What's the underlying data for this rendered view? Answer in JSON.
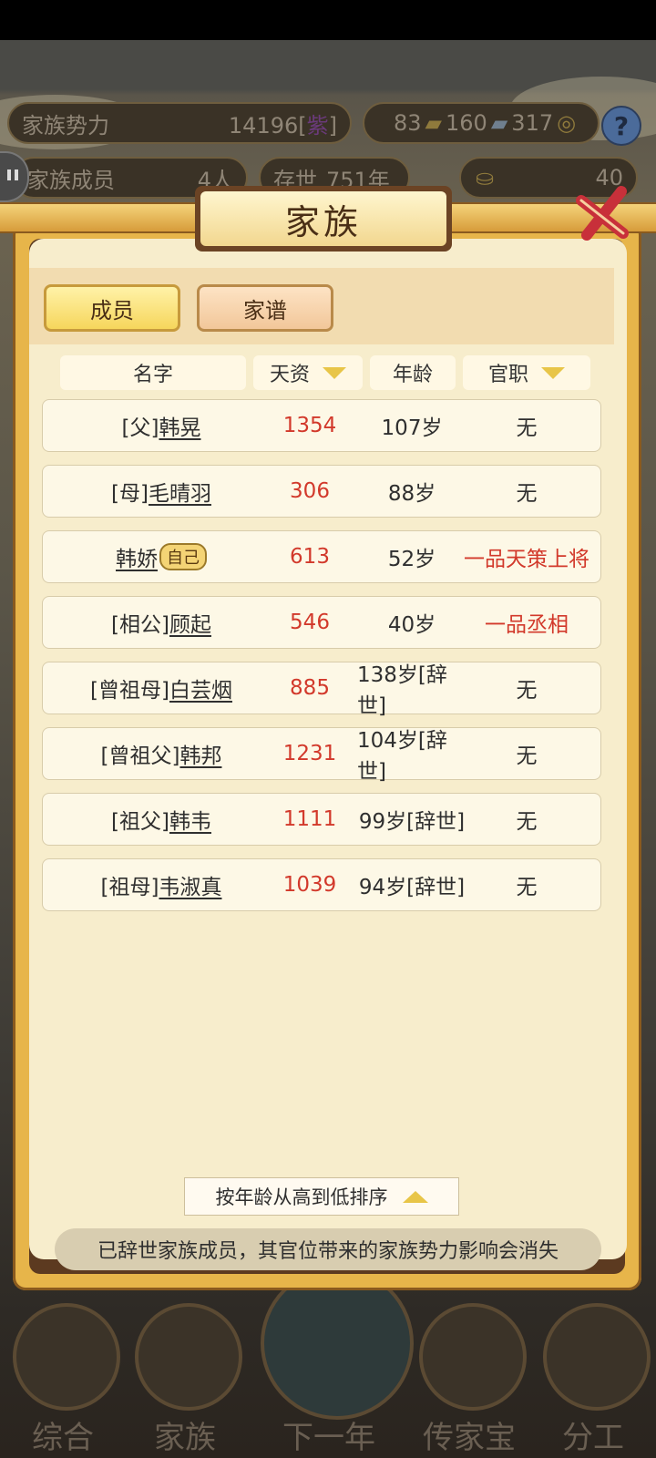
{
  "hud": {
    "power_label": "家族势力",
    "power_value": "14196[",
    "power_tier": "紫",
    "power_suffix": "]",
    "currency1": "83",
    "currency2": "160",
    "currency3": "317",
    "members_label": "家族成员",
    "members_value": "4人",
    "alive_label": "存世",
    "alive_value": "751年",
    "gold_value": "40"
  },
  "dialog": {
    "title": "家族",
    "tabs": [
      {
        "label": "成员",
        "active": true
      },
      {
        "label": "家谱",
        "active": false
      }
    ],
    "columns": [
      "名字",
      "天资",
      "年龄",
      "官职"
    ],
    "rows": [
      {
        "relation": "[父]",
        "name": "韩晃",
        "talent": "1354",
        "age": "107岁",
        "office": "无",
        "office_highlight": false
      },
      {
        "relation": "[母]",
        "name": "毛晴羽",
        "talent": "306",
        "age": "88岁",
        "office": "无",
        "office_highlight": false
      },
      {
        "relation": "",
        "name": "韩娇",
        "badge": "自己",
        "talent": "613",
        "age": "52岁",
        "office": "一品天策上将",
        "office_highlight": true
      },
      {
        "relation": "[相公]",
        "name": "顾起",
        "talent": "546",
        "age": "40岁",
        "office": "一品丞相",
        "office_highlight": true
      },
      {
        "relation": "[曾祖母]",
        "name": "白芸烟",
        "talent": "885",
        "age": "138岁[辞世]",
        "office": "无",
        "office_highlight": false
      },
      {
        "relation": "[曾祖父]",
        "name": "韩邦",
        "talent": "1231",
        "age": "104岁[辞世]",
        "office": "无",
        "office_highlight": false
      },
      {
        "relation": "[祖父]",
        "name": "韩韦",
        "talent": "1111",
        "age": "99岁[辞世]",
        "office": "无",
        "office_highlight": false
      },
      {
        "relation": "[祖母]",
        "name": "韦淑真",
        "talent": "1039",
        "age": "94岁[辞世]",
        "office": "无",
        "office_highlight": false
      }
    ],
    "sort_label": "按年龄从高到低排序",
    "notice": "已辞世家族成员，其官位带来的家族势力影响会消失"
  },
  "bottom_nav": [
    "综合",
    "家族",
    "下一年",
    "传家宝",
    "分工"
  ],
  "colors": {
    "accent_red": "#d2392b",
    "panel_bg": "#f7edcc",
    "frame_gold": "#e7b54a"
  }
}
